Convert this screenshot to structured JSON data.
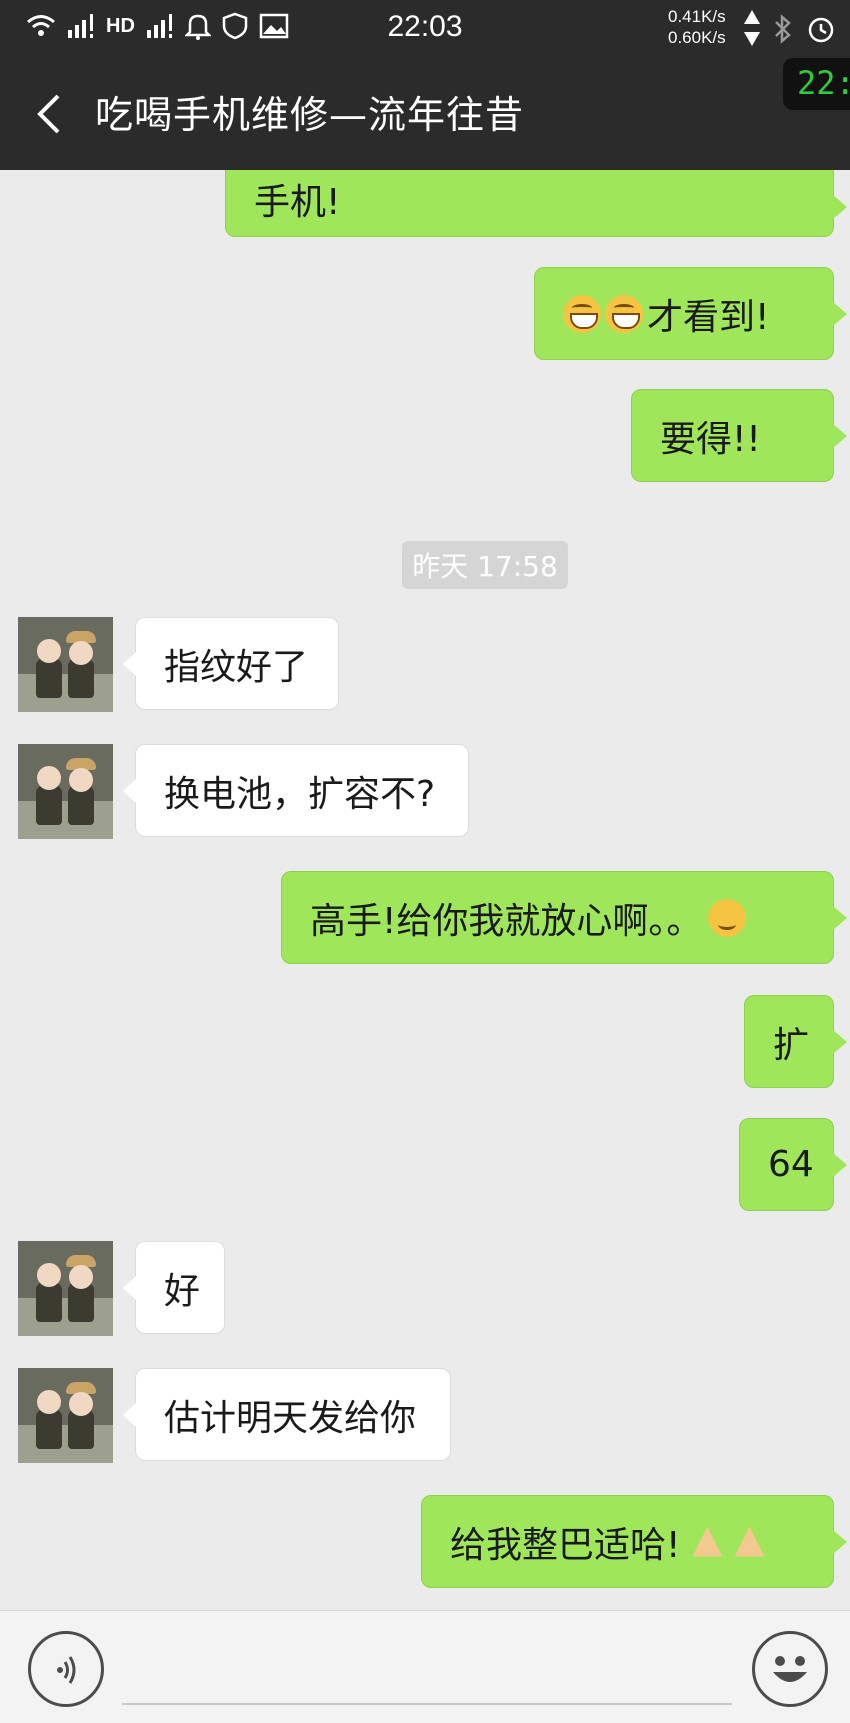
{
  "status_bar": {
    "time": "22:03",
    "speed_up": "0.41K/s",
    "speed_down": "0.60K/s",
    "hd_label": "HD",
    "clock_badge": "22:"
  },
  "header": {
    "title": "吃喝手机维修—流年往昔"
  },
  "timestamp": "昨天 17:58",
  "messages": {
    "m0": "手机!",
    "m1": "才看到!",
    "m2": "要得!!",
    "m3": "指纹好了",
    "m4": "换电池，扩容不?",
    "m5": "高手!给你我就放心啊。。",
    "m6": "扩",
    "m7": "64",
    "m8": "好",
    "m9": "估计明天发给你",
    "m10": "给我整巴适哈!"
  },
  "colors": {
    "outgoing_bubble": "#9fe65b",
    "incoming_bubble": "#ffffff",
    "header_bg": "#2b2b2b",
    "chat_bg": "#ebebeb"
  },
  "icons": {
    "back": "chevron-left-icon",
    "voice": "voice-icon",
    "emoji": "smiley-icon"
  }
}
